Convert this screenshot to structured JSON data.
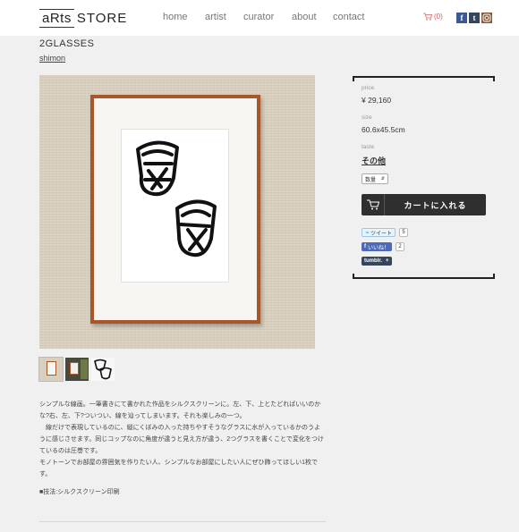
{
  "header": {
    "logo_box": "aRts",
    "logo_text": "STORE",
    "nav": [
      {
        "label": "home"
      },
      {
        "label": "artist"
      },
      {
        "label": "curator"
      },
      {
        "label": "about"
      },
      {
        "label": "contact"
      }
    ],
    "cart_count": "(0)",
    "social": {
      "facebook": "f",
      "tumblr": "t"
    }
  },
  "product": {
    "title": "2GLASSES",
    "artist": "shimon",
    "description": [
      "シンプルな線画。一筆書きにて書かれた作品をシルクスクリーンに。左、下、上とたどればいいのかな?右、左、下?ついつい、線を辿ってしまいます。それも楽しみの一つ。",
      "　線だけで表現しているのに、縦にくぼみの入った持ちやすそうなグラスに水が入っているかのうように感じさせます。同じコップなのに角度が違うと見え方が違う、2つグラスを書くことで変化をつけているのは圧巻です。",
      "モノトーンでお部屋の雰囲気を作りたい人、シンプルなお部屋にしたい人にぜひ飾ってほしい1枚です。"
    ],
    "method": "■技法:シルクスクリーン印刷"
  },
  "sidebar": {
    "price_label": "price",
    "price": "¥ 29,160",
    "size_label": "size",
    "size": "60.6x45.5cm",
    "taste_label": "taste",
    "taste": "その他",
    "qty_label": "数量",
    "cart_button": "カートに入れる",
    "tweet_label": "ツイート",
    "tweet_count": "5",
    "like_label": "いいね！",
    "like_count": "2",
    "tumblr_label": "tumblr."
  },
  "colors": {
    "background": "#f0f0f0",
    "frame": "#a8572b",
    "cart_button": "#2f2f2f",
    "facebook": "#3b5998",
    "twitter": "#55acee",
    "tumblr": "#35465c"
  }
}
